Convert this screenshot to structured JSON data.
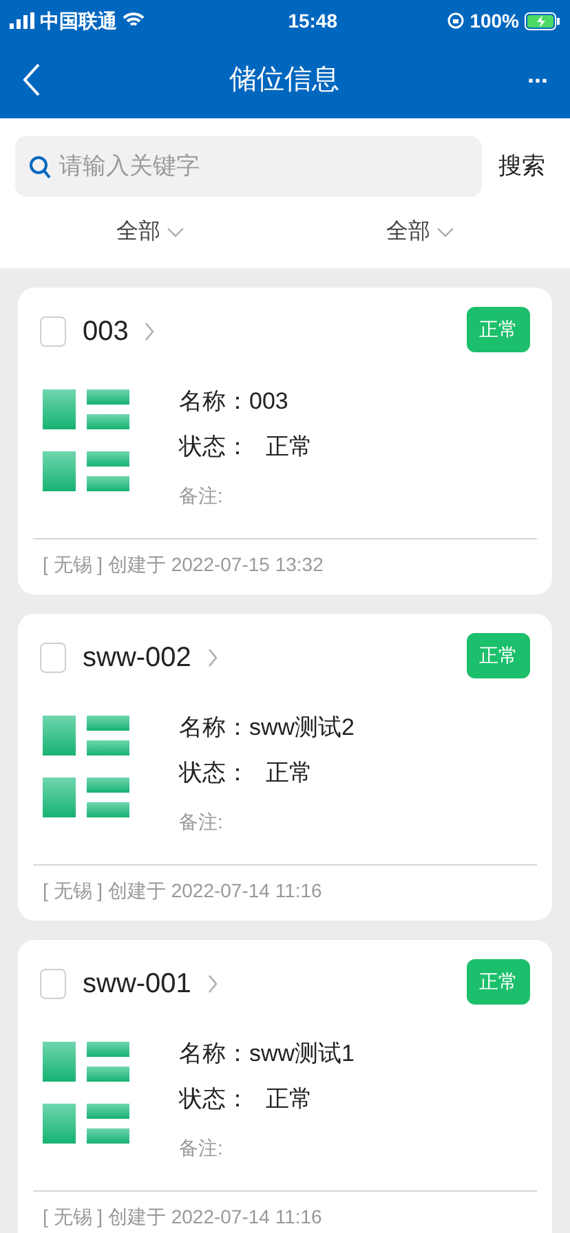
{
  "status_bar": {
    "carrier": "中国联通",
    "time": "15:48",
    "battery": "100%"
  },
  "nav": {
    "title": "储位信息",
    "more": "..."
  },
  "search": {
    "placeholder": "请输入关键字",
    "button": "搜索"
  },
  "filters": [
    {
      "label": "全部"
    },
    {
      "label": "全部"
    }
  ],
  "cards": [
    {
      "code": "003",
      "checked": false,
      "badge": "正常",
      "name_label": "名称：",
      "name": "003",
      "status_label": "状态：",
      "status": "正常",
      "remark_label": "备注:",
      "footer": "[ 无锡 ] 创建于 2022-07-15 13:32"
    },
    {
      "code": "sww-002",
      "checked": false,
      "badge": "正常",
      "name_label": "名称：",
      "name": "sww测试2",
      "status_label": "状态：",
      "status": "正常",
      "remark_label": "备注:",
      "footer": "[ 无锡 ] 创建于 2022-07-14 11:16"
    },
    {
      "code": "sww-001",
      "checked": false,
      "badge": "正常",
      "name_label": "名称：",
      "name": "sww测试1",
      "status_label": "状态：",
      "status": "正常",
      "remark_label": "备注:",
      "footer": "[ 无锡 ] 创建于 2022-07-14 11:16"
    }
  ]
}
